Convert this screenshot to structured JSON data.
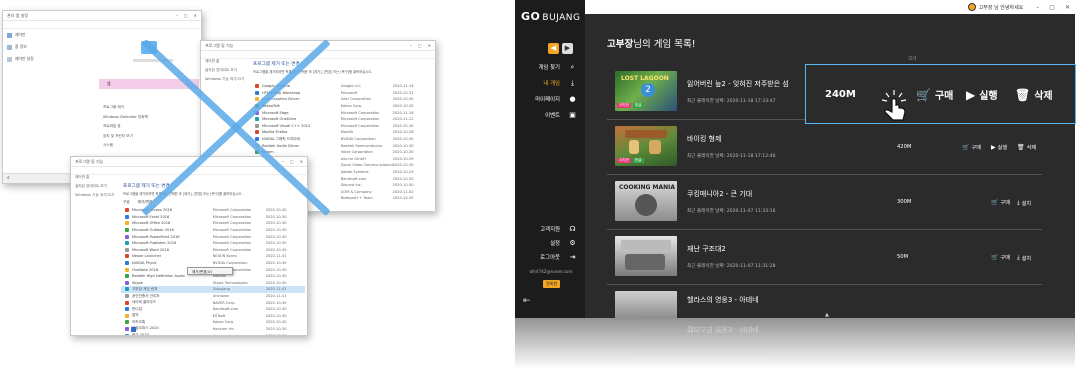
{
  "left_panel": {
    "win1": {
      "title": "관리 앱 설정",
      "nav": [
        "제어판",
        "홈 정보",
        "제어판 설정"
      ],
      "items": [
        "앱",
        "프로그램 제거",
        "Windows Defender 방화벽",
        "프로파일 등",
        "장치 및 프린터 보기",
        "시스템"
      ]
    },
    "win2": {
      "title": "프로그램 및 기능",
      "heading": "프로그램 제거 또는 변경",
      "desc": "프로그램을 제거하려면 목록에서 선택한 후 [제거], [변경] 또는 [복구]를 클릭하십시오.",
      "nav": [
        "제어판 홈",
        "설치된 업데이트 보기",
        "Windows 기능 켜기/끄기"
      ],
      "rows": [
        [
          "Google Chrome",
          "Google LLC",
          "2020-11-14"
        ],
        [
          "HTML Help Workshop",
          "Microsoft",
          "2020-10-31"
        ],
        [
          "Intel Graphics Driver",
          "Intel Corporation",
          "2020-10-30"
        ],
        [
          "KakaoTalk",
          "Kakao Corp.",
          "2020-10-30"
        ],
        [
          "Microsoft Edge",
          "Microsoft Corporation",
          "2020-11-16"
        ],
        [
          "Microsoft OneDrive",
          "Microsoft Corporation",
          "2020-11-12"
        ],
        [
          "Microsoft Visual C++ 2015",
          "Microsoft Corporation",
          "2020-10-30"
        ],
        [
          "Mozilla Firefox",
          "Mozilla",
          "2020-10-28"
        ],
        [
          "NVIDIA 그래픽 드라이버",
          "NVIDIA Corporation",
          "2020-10-30"
        ],
        [
          "Realtek Audio Driver",
          "Realtek Semiconductor",
          "2020-10-30"
        ],
        [
          "Steam",
          "Valve Corporation",
          "2020-10-30"
        ],
        [
          "WinRAR 5.91",
          "win.rar GmbH",
          "2020-10-29"
        ],
        [
          "Zoom",
          "Zoom Video Communications",
          "2020-10-30"
        ],
        [
          "Adobe Acrobat Reader DC",
          "Adobe Systems",
          "2020-10-29"
        ],
        [
          "Bandizip",
          "Bandisoft.com",
          "2020-10-30"
        ],
        [
          "Discord",
          "Discord Inc.",
          "2020-10-30"
        ],
        [
          "GOM Player",
          "GOM & Company",
          "2020-11-02"
        ],
        [
          "Notepad++",
          "Notepad++ Team",
          "2020-10-30"
        ]
      ]
    },
    "win3": {
      "title": "프로그램 및 기능",
      "heading": "프로그램 제거 또는 변경",
      "desc": "프로그램을 제거하려면 목록에서 선택한 후 [제거], [변경] 또는 [복구]를 클릭하십시오.",
      "nav": [
        "제어판 홈",
        "설치된 업데이트 보기",
        "Windows 기능 켜기/끄기"
      ],
      "toolbar": [
        "구성",
        "제거/변경"
      ],
      "context_menu": "제거/변경(U)",
      "rows": [
        [
          "Microsoft Access 2016",
          "Microsoft Corporation",
          "2020-10-30"
        ],
        [
          "Microsoft Excel 2016",
          "Microsoft Corporation",
          "2020-10-30"
        ],
        [
          "Microsoft Office 2016",
          "Microsoft Corporation",
          "2020-10-30"
        ],
        [
          "Microsoft Outlook 2016",
          "Microsoft Corporation",
          "2020-10-30"
        ],
        [
          "Microsoft PowerPoint 2016",
          "Microsoft Corporation",
          "2020-10-30"
        ],
        [
          "Microsoft Publisher 2016",
          "Microsoft Corporation",
          "2020-10-30"
        ],
        [
          "Microsoft Word 2016",
          "Microsoft Corporation",
          "2020-10-30"
        ],
        [
          "Nexon Launcher",
          "NEXON Korea",
          "2020-11-01"
        ],
        [
          "NVIDIA PhysX",
          "NVIDIA Corporation",
          "2020-10-30"
        ],
        [
          "OneNote 2016",
          "Microsoft Corporation",
          "2020-10-30"
        ],
        [
          "Realtek High Definition Audio",
          "Realtek",
          "2020-10-30"
        ],
        [
          "Skype",
          "Skype Technologies",
          "2020-10-30"
        ],
        [
          "고부장 게임 런처",
          "Gobujang",
          "2020-11-01"
        ],
        [
          "공인인증서 관리자",
          "Unknown",
          "2020-11-01"
        ],
        [
          "네이버 클라우드",
          "NAVER Corp.",
          "2020-10-30"
        ],
        [
          "반디집",
          "Bandisoft.com",
          "2020-10-30"
        ],
        [
          "알약",
          "ESTsoft",
          "2020-10-30"
        ],
        [
          "카카오톡",
          "Kakao Corp.",
          "2020-10-30"
        ],
        [
          "한컴오피스 2020",
          "Hancom Inc.",
          "2020-10-30"
        ],
        [
          "한글 2020",
          "Hancom Inc.",
          "2020-10-30"
        ],
        [
          "Visual Studio Code",
          "Microsoft Corporation",
          "2020-10-30"
        ],
        [
          "Windows 10 업데이트 도우미",
          "Microsoft Corporation",
          "2020-10-30"
        ]
      ]
    }
  },
  "app": {
    "logo": "GO",
    "logo_sub": "BUJANG",
    "greeting": "고부장 님 안녕하세요",
    "sidebar": {
      "items": [
        "게임 찾기",
        "내 게임",
        "마이페이지",
        "이벤트"
      ],
      "bottom_items": [
        "고객지원",
        "설정",
        "로그아웃"
      ],
      "email": "olh4742@naver.com",
      "badge": "정회원"
    },
    "page_title_name": "고부장",
    "page_title_suffix": "님의 게임 목록!",
    "column_size": "크기",
    "games": [
      {
        "name": "잃어버린 늪2 - 잊혀진 저주받은 섬",
        "date": "최근 플레이한 날짜: 2020-11-18 17:33:47",
        "size": "240M",
        "actions": [
          "구매",
          "실행",
          "삭제"
        ]
      },
      {
        "name": "바이킹 형제",
        "date": "최근 플레이한 날짜: 2020-11-18 17:12:46",
        "size": "420M",
        "actions": [
          "구매",
          "실행",
          "삭제"
        ]
      },
      {
        "name": "쿠킹매니아2 - 큰 기대",
        "date": "최근 플레이한 날짜: 2020-11-07 11:33:16",
        "size": "300M",
        "actions": [
          "구매",
          "설치"
        ]
      },
      {
        "name": "재난 구조대2",
        "date": "최근 플레이한 날짜: 2020-11-07 11:31:28",
        "size": "50M",
        "actions": [
          "구매",
          "설치"
        ]
      },
      {
        "name": "헬라스의 영웅3 - 아테네",
        "date": "",
        "size": "",
        "actions": []
      }
    ],
    "reflection_text": "헬라스의 영웅3 - 아테네",
    "thumb_labels": [
      "사지만",
      "한글"
    ]
  }
}
